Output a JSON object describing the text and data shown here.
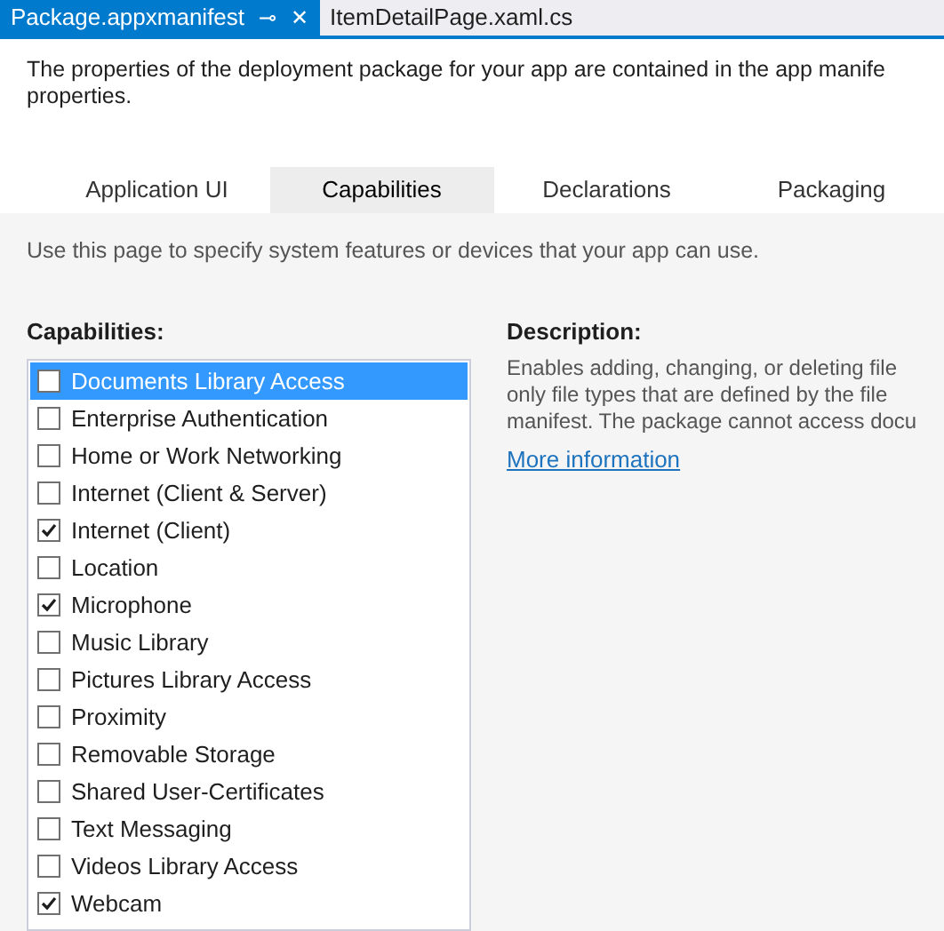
{
  "document_tabs": [
    {
      "label": "Package.appxmanifest",
      "selected": true,
      "pin": "⊸",
      "close": "✕"
    },
    {
      "label": "ItemDetailPage.xaml.cs",
      "selected": false
    }
  ],
  "intro": [
    "The properties of the deployment package for your app are contained in the app manife",
    "properties."
  ],
  "tabs": [
    {
      "label": "Application UI",
      "selected": false
    },
    {
      "label": "Capabilities",
      "selected": true
    },
    {
      "label": "Declarations",
      "selected": false
    },
    {
      "label": "Packaging",
      "selected": false
    }
  ],
  "instructions": "Use this page to specify system features or devices that your app can use.",
  "capabilities": {
    "title": "Capabilities:",
    "items": [
      {
        "label": "Documents Library Access",
        "checked": false,
        "selected": true
      },
      {
        "label": "Enterprise Authentication",
        "checked": false,
        "selected": false
      },
      {
        "label": "Home or Work Networking",
        "checked": false,
        "selected": false
      },
      {
        "label": "Internet (Client & Server)",
        "checked": false,
        "selected": false
      },
      {
        "label": "Internet (Client)",
        "checked": true,
        "selected": false
      },
      {
        "label": "Location",
        "checked": false,
        "selected": false
      },
      {
        "label": "Microphone",
        "checked": true,
        "selected": false
      },
      {
        "label": "Music Library",
        "checked": false,
        "selected": false
      },
      {
        "label": "Pictures Library Access",
        "checked": false,
        "selected": false
      },
      {
        "label": "Proximity",
        "checked": false,
        "selected": false
      },
      {
        "label": "Removable Storage",
        "checked": false,
        "selected": false
      },
      {
        "label": "Shared User-Certificates",
        "checked": false,
        "selected": false
      },
      {
        "label": "Text Messaging",
        "checked": false,
        "selected": false
      },
      {
        "label": "Videos Library Access",
        "checked": false,
        "selected": false
      },
      {
        "label": "Webcam",
        "checked": true,
        "selected": false
      }
    ]
  },
  "description": {
    "title": "Description:",
    "lines": [
      "Enables adding, changing, or deleting file",
      "only file types that are defined by the file",
      "manifest. The package cannot access docu"
    ],
    "link": "More information"
  }
}
